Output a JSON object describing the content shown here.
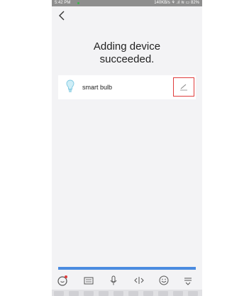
{
  "status_bar": {
    "time": "5:42 PM",
    "indicators": "140KB/s ⚘ .ıl ≋ ▭ 82%"
  },
  "header": {
    "back_icon": "chevron-left-icon"
  },
  "page": {
    "title_line1": "Adding device",
    "title_line2": "succeeded."
  },
  "device": {
    "name": "smart bulb",
    "icon": "lightbulb-icon",
    "edit_icon": "pencil-icon"
  },
  "keyboard_toolbar": {
    "icons": [
      "ime-logo-icon",
      "keyboard-icon",
      "microphone-icon",
      "cursor-move-icon",
      "emoji-icon",
      "collapse-keyboard-icon"
    ]
  },
  "colors": {
    "accent": "#4a8be0",
    "highlight_border": "#e03c3c",
    "bulb": "#9fd9ec",
    "status_bar": "#8e8e8e",
    "background": "#f3f3f5"
  }
}
